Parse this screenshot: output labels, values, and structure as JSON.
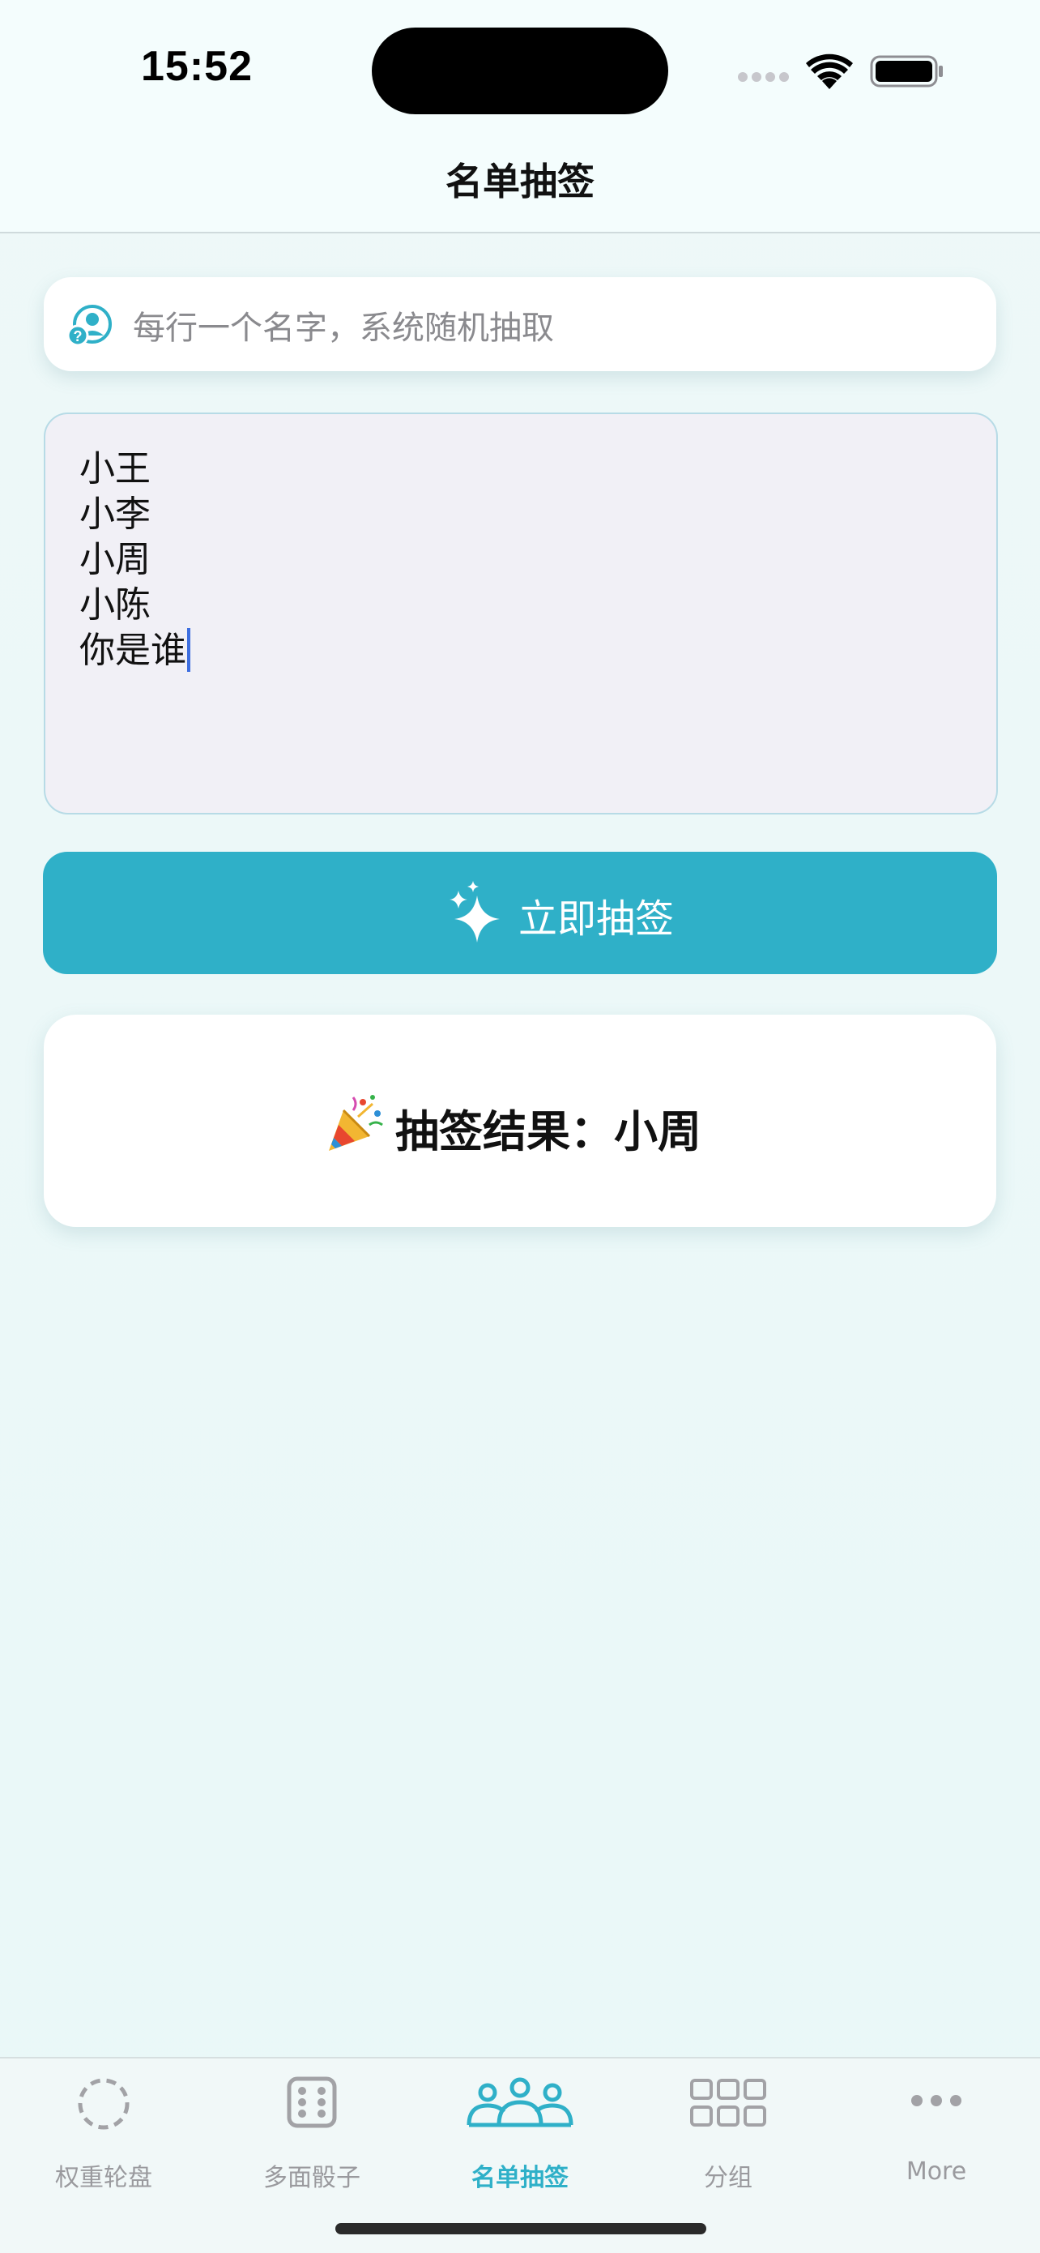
{
  "status_bar": {
    "time": "15:52"
  },
  "nav": {
    "title": "名单抽签"
  },
  "hint": {
    "text": "每行一个名字，系统随机抽取",
    "icon": "person-question-icon"
  },
  "names_input": {
    "lines": [
      "小王",
      "小李",
      "小周",
      "小陈",
      "你是谁"
    ]
  },
  "draw_button": {
    "label": "立即抽签",
    "icon": "sparkles-icon"
  },
  "result": {
    "icon": "party-popper-icon",
    "text": "抽签结果：小周"
  },
  "tab_bar": {
    "tabs": [
      {
        "label": "权重轮盘",
        "icon": "dashed-circle-icon",
        "active": false
      },
      {
        "label": "多面骰子",
        "icon": "dice-icon",
        "active": false
      },
      {
        "label": "名单抽签",
        "icon": "people-group-icon",
        "active": true
      },
      {
        "label": "分组",
        "icon": "grid-icon",
        "active": false
      },
      {
        "label": "More",
        "icon": "more-dots-icon",
        "active": false
      }
    ]
  },
  "colors": {
    "accent": "#2fb0c8",
    "background": "#eaf8f8",
    "inactive_tab": "#9a9a9e"
  }
}
